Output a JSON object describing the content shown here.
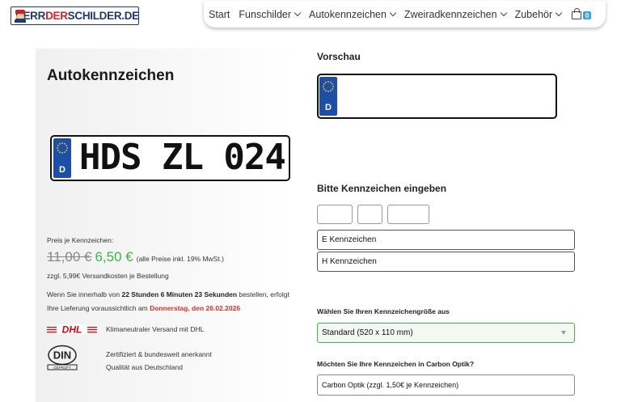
{
  "header": {
    "logo_parts": [
      "HERR",
      "DER",
      "SCHILDER.DE"
    ],
    "nav": [
      {
        "label": "Start",
        "has_dropdown": false
      },
      {
        "label": "Funschilder",
        "has_dropdown": true
      },
      {
        "label": "Autokennzeichen",
        "has_dropdown": true
      },
      {
        "label": "Zweiradkennzeichen",
        "has_dropdown": true
      },
      {
        "label": "Zubehör",
        "has_dropdown": true
      }
    ],
    "cart_count": "0",
    "cart_icon": "shopping-bag-icon"
  },
  "product": {
    "title": "Autokennzeichen",
    "plate_country": "D",
    "plate_text": "HDS ZL 024",
    "price_label": "Preis je Kennzeichen:",
    "old_price": "11,00 €",
    "new_price": "6,50 €",
    "vat_note": "(alle Preise inkl. 19% MwSt.)",
    "shipping": "zzgl. 5,99€ Versandkosten je Bestellung",
    "delivery_prefix": "Wenn Sie innerhalb von ",
    "delivery_countdown": "22 Stunden 6 Minuten 23 Sekunden",
    "delivery_middle": " bestellen, erfolgt Ihre Lieferung voraussichtlich am ",
    "delivery_date": "Donnerstag, den 26.02.2026",
    "dhl_logo_text": "DHL",
    "dhl_text": "Klimaneutraler Versand mit DHL",
    "din_logo_text": "DIN",
    "din_logo_subtext": "GEPRÜFT",
    "din_line1": "Zertifiziert & bundesweit anerkannt",
    "din_line2": "Qualität aus Deutschland"
  },
  "configurator": {
    "preview_title": "Vorschau",
    "preview_country": "D",
    "enter_title": "Bitte Kennzeichen eingeben",
    "field_district": "",
    "field_letters": "",
    "field_numbers": "",
    "e_field_value": "E Kennzeichen",
    "h_field_value": "H Kennzeichen",
    "size_label": "Wählen Sie Ihren Kennzeichengröße aus",
    "size_value": "Standard (520 x 110 mm)",
    "carbon_label": "Möchten Sie Ihre Kennzeichen in Carbon Optik?",
    "carbon_value": "Carbon Optik (zzgl. 1,50€ je Kennzeichen)"
  },
  "colors": {
    "eu_blue": "#1d4fa8",
    "price_green": "#3cb54a",
    "date_red": "#d8322e",
    "logo_navy": "#1f3a6e",
    "cart_badge": "#39a3e6"
  }
}
